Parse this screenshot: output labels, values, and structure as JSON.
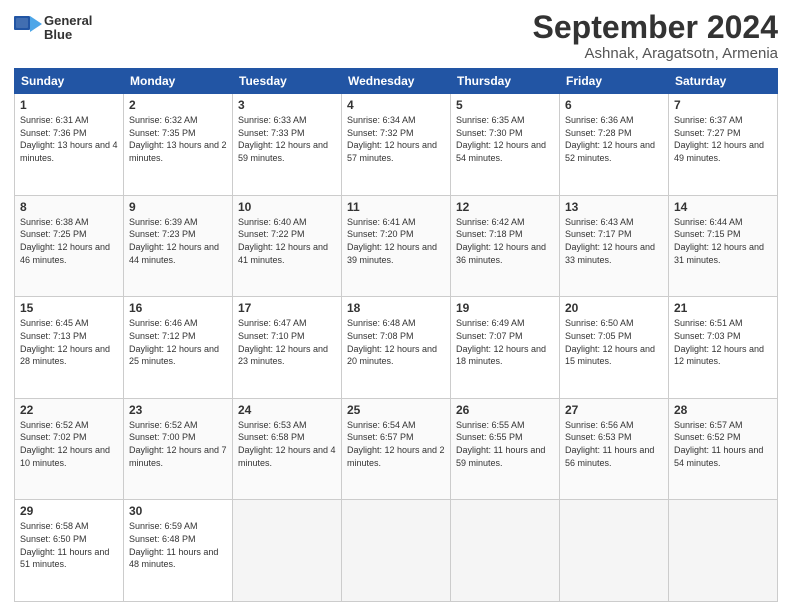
{
  "logo": {
    "line1": "General",
    "line2": "Blue"
  },
  "title": "September 2024",
  "subtitle": "Ashnak, Aragatsotn, Armenia",
  "weekdays": [
    "Sunday",
    "Monday",
    "Tuesday",
    "Wednesday",
    "Thursday",
    "Friday",
    "Saturday"
  ],
  "weeks": [
    [
      {
        "num": "1",
        "sunrise": "Sunrise: 6:31 AM",
        "sunset": "Sunset: 7:36 PM",
        "daylight": "Daylight: 13 hours and 4 minutes."
      },
      {
        "num": "2",
        "sunrise": "Sunrise: 6:32 AM",
        "sunset": "Sunset: 7:35 PM",
        "daylight": "Daylight: 13 hours and 2 minutes."
      },
      {
        "num": "3",
        "sunrise": "Sunrise: 6:33 AM",
        "sunset": "Sunset: 7:33 PM",
        "daylight": "Daylight: 12 hours and 59 minutes."
      },
      {
        "num": "4",
        "sunrise": "Sunrise: 6:34 AM",
        "sunset": "Sunset: 7:32 PM",
        "daylight": "Daylight: 12 hours and 57 minutes."
      },
      {
        "num": "5",
        "sunrise": "Sunrise: 6:35 AM",
        "sunset": "Sunset: 7:30 PM",
        "daylight": "Daylight: 12 hours and 54 minutes."
      },
      {
        "num": "6",
        "sunrise": "Sunrise: 6:36 AM",
        "sunset": "Sunset: 7:28 PM",
        "daylight": "Daylight: 12 hours and 52 minutes."
      },
      {
        "num": "7",
        "sunrise": "Sunrise: 6:37 AM",
        "sunset": "Sunset: 7:27 PM",
        "daylight": "Daylight: 12 hours and 49 minutes."
      }
    ],
    [
      {
        "num": "8",
        "sunrise": "Sunrise: 6:38 AM",
        "sunset": "Sunset: 7:25 PM",
        "daylight": "Daylight: 12 hours and 46 minutes."
      },
      {
        "num": "9",
        "sunrise": "Sunrise: 6:39 AM",
        "sunset": "Sunset: 7:23 PM",
        "daylight": "Daylight: 12 hours and 44 minutes."
      },
      {
        "num": "10",
        "sunrise": "Sunrise: 6:40 AM",
        "sunset": "Sunset: 7:22 PM",
        "daylight": "Daylight: 12 hours and 41 minutes."
      },
      {
        "num": "11",
        "sunrise": "Sunrise: 6:41 AM",
        "sunset": "Sunset: 7:20 PM",
        "daylight": "Daylight: 12 hours and 39 minutes."
      },
      {
        "num": "12",
        "sunrise": "Sunrise: 6:42 AM",
        "sunset": "Sunset: 7:18 PM",
        "daylight": "Daylight: 12 hours and 36 minutes."
      },
      {
        "num": "13",
        "sunrise": "Sunrise: 6:43 AM",
        "sunset": "Sunset: 7:17 PM",
        "daylight": "Daylight: 12 hours and 33 minutes."
      },
      {
        "num": "14",
        "sunrise": "Sunrise: 6:44 AM",
        "sunset": "Sunset: 7:15 PM",
        "daylight": "Daylight: 12 hours and 31 minutes."
      }
    ],
    [
      {
        "num": "15",
        "sunrise": "Sunrise: 6:45 AM",
        "sunset": "Sunset: 7:13 PM",
        "daylight": "Daylight: 12 hours and 28 minutes."
      },
      {
        "num": "16",
        "sunrise": "Sunrise: 6:46 AM",
        "sunset": "Sunset: 7:12 PM",
        "daylight": "Daylight: 12 hours and 25 minutes."
      },
      {
        "num": "17",
        "sunrise": "Sunrise: 6:47 AM",
        "sunset": "Sunset: 7:10 PM",
        "daylight": "Daylight: 12 hours and 23 minutes."
      },
      {
        "num": "18",
        "sunrise": "Sunrise: 6:48 AM",
        "sunset": "Sunset: 7:08 PM",
        "daylight": "Daylight: 12 hours and 20 minutes."
      },
      {
        "num": "19",
        "sunrise": "Sunrise: 6:49 AM",
        "sunset": "Sunset: 7:07 PM",
        "daylight": "Daylight: 12 hours and 18 minutes."
      },
      {
        "num": "20",
        "sunrise": "Sunrise: 6:50 AM",
        "sunset": "Sunset: 7:05 PM",
        "daylight": "Daylight: 12 hours and 15 minutes."
      },
      {
        "num": "21",
        "sunrise": "Sunrise: 6:51 AM",
        "sunset": "Sunset: 7:03 PM",
        "daylight": "Daylight: 12 hours and 12 minutes."
      }
    ],
    [
      {
        "num": "22",
        "sunrise": "Sunrise: 6:52 AM",
        "sunset": "Sunset: 7:02 PM",
        "daylight": "Daylight: 12 hours and 10 minutes."
      },
      {
        "num": "23",
        "sunrise": "Sunrise: 6:52 AM",
        "sunset": "Sunset: 7:00 PM",
        "daylight": "Daylight: 12 hours and 7 minutes."
      },
      {
        "num": "24",
        "sunrise": "Sunrise: 6:53 AM",
        "sunset": "Sunset: 6:58 PM",
        "daylight": "Daylight: 12 hours and 4 minutes."
      },
      {
        "num": "25",
        "sunrise": "Sunrise: 6:54 AM",
        "sunset": "Sunset: 6:57 PM",
        "daylight": "Daylight: 12 hours and 2 minutes."
      },
      {
        "num": "26",
        "sunrise": "Sunrise: 6:55 AM",
        "sunset": "Sunset: 6:55 PM",
        "daylight": "Daylight: 11 hours and 59 minutes."
      },
      {
        "num": "27",
        "sunrise": "Sunrise: 6:56 AM",
        "sunset": "Sunset: 6:53 PM",
        "daylight": "Daylight: 11 hours and 56 minutes."
      },
      {
        "num": "28",
        "sunrise": "Sunrise: 6:57 AM",
        "sunset": "Sunset: 6:52 PM",
        "daylight": "Daylight: 11 hours and 54 minutes."
      }
    ],
    [
      {
        "num": "29",
        "sunrise": "Sunrise: 6:58 AM",
        "sunset": "Sunset: 6:50 PM",
        "daylight": "Daylight: 11 hours and 51 minutes."
      },
      {
        "num": "30",
        "sunrise": "Sunrise: 6:59 AM",
        "sunset": "Sunset: 6:48 PM",
        "daylight": "Daylight: 11 hours and 48 minutes."
      },
      null,
      null,
      null,
      null,
      null
    ]
  ]
}
